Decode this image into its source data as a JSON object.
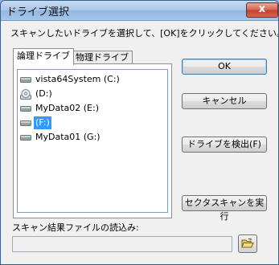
{
  "window": {
    "title": "ドライブ選択",
    "close_glyph": "x"
  },
  "instruction": "スキャンしたいドライブを選択して、[OK]をクリックしてください。",
  "tabs": [
    {
      "label": "論理ドライブ",
      "active": true
    },
    {
      "label": "物理ドライブ",
      "active": false
    }
  ],
  "drives": [
    {
      "label": "vista64System (C:)",
      "icon": "hard-drive-icon",
      "selected": false
    },
    {
      "label": "(D:)",
      "icon": "cd-drive-icon",
      "selected": false
    },
    {
      "label": "MyData02 (E:)",
      "icon": "hard-drive-icon",
      "selected": false
    },
    {
      "label": "(F:)",
      "icon": "hard-drive-icon",
      "selected": true
    },
    {
      "label": "MyData01 (G:)",
      "icon": "hard-drive-icon",
      "selected": false
    }
  ],
  "buttons": {
    "ok": "OK",
    "cancel": "キャンセル",
    "detect": "ドライブを検出(F)",
    "sector_scan": "セクタスキャンを実行"
  },
  "file_section": {
    "label": "スキャン結果ファイルの読込み:",
    "value": ""
  },
  "colors": {
    "selection": "#3399ff",
    "title_bar": "#a9c7e8",
    "close_button": "#c2422e"
  }
}
